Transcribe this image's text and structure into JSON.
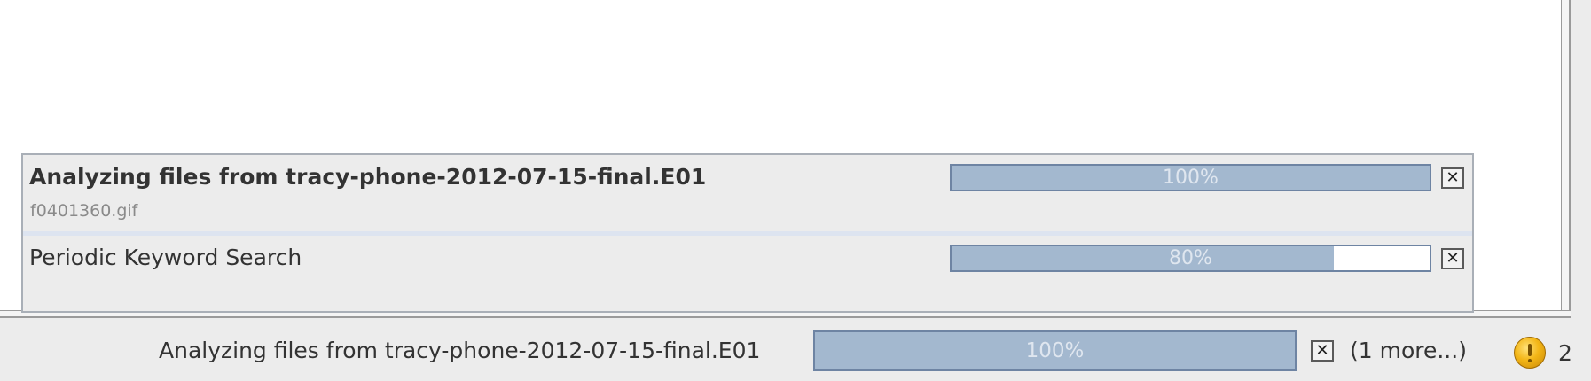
{
  "popup": {
    "tasks": [
      {
        "title": "Analyzing files from tracy-phone-2012-07-15-final.E01",
        "subtitle": "f0401360.gif",
        "progress_percent": 100,
        "progress_label": "100%",
        "cancel_glyph": "✕"
      },
      {
        "title": "Periodic Keyword Search",
        "progress_percent": 80,
        "progress_label": "80%",
        "cancel_glyph": "✕"
      }
    ]
  },
  "status_bar": {
    "task_label": "Analyzing files from tracy-phone-2012-07-15-final.E01",
    "progress_percent": 100,
    "progress_label": "100%",
    "cancel_glyph": "✕",
    "more_label": "(1 more...)",
    "notification_icon": "warning-icon",
    "notification_count": "2"
  },
  "colors": {
    "progress_fill": "#a3b8cf",
    "progress_border": "#6e84a3",
    "notification": "#f3b617"
  }
}
